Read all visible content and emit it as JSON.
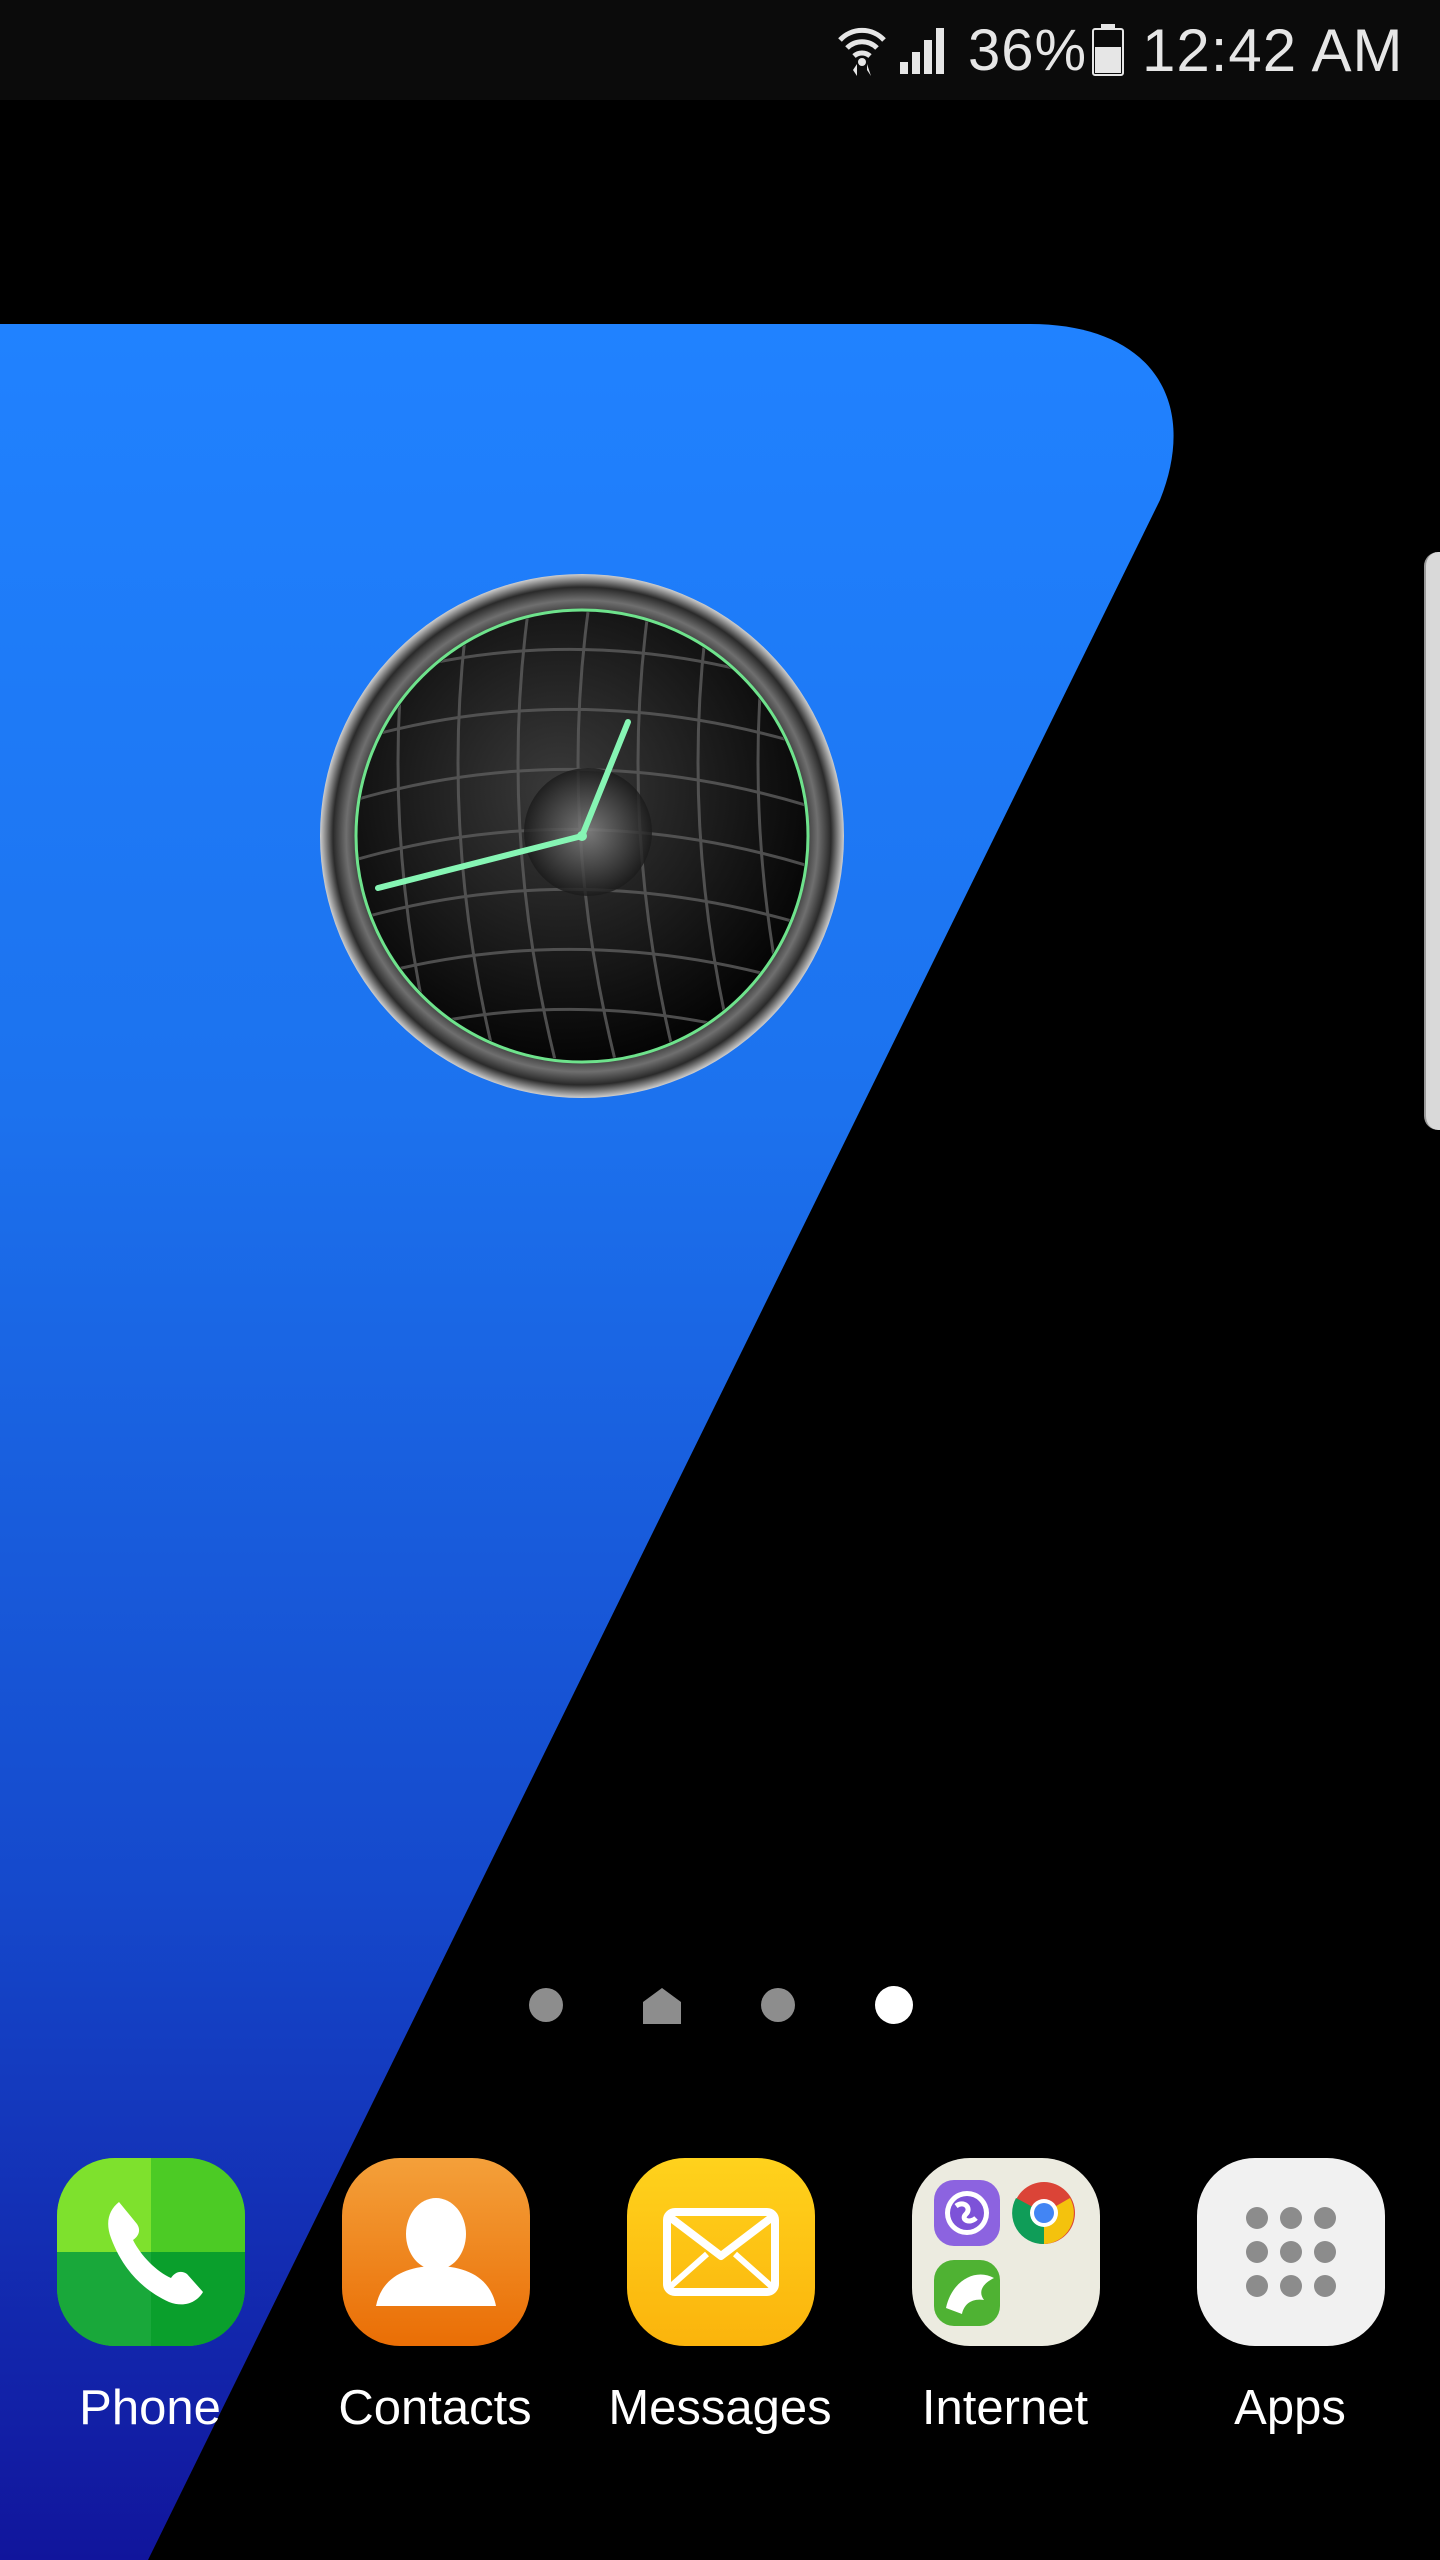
{
  "status_bar": {
    "battery_percent": "36%",
    "time": "12:42 AM",
    "icons": [
      "wifi-icon",
      "cell-signal-icon",
      "battery-icon"
    ]
  },
  "home_screen": {
    "pages": 4,
    "current_page": 4,
    "home_page": 2
  },
  "dock": {
    "apps": [
      {
        "label": "Phone",
        "icon": "phone-icon",
        "color": "#3cc21c"
      },
      {
        "label": "Contacts",
        "icon": "contacts-icon",
        "color": "#f07c12"
      },
      {
        "label": "Messages",
        "icon": "messages-icon",
        "color": "#ffc414"
      },
      {
        "label": "Internet",
        "icon": "internet-folder-icon",
        "color": "#eeece2"
      },
      {
        "label": "Apps",
        "icon": "apps-grid-icon",
        "color": "#f2f2f2"
      }
    ]
  },
  "colors": {
    "wallpaper_blue_top": "#1f7fff",
    "wallpaper_blue_bottom": "#1212a0",
    "clock_hands": "#86f5b4"
  }
}
